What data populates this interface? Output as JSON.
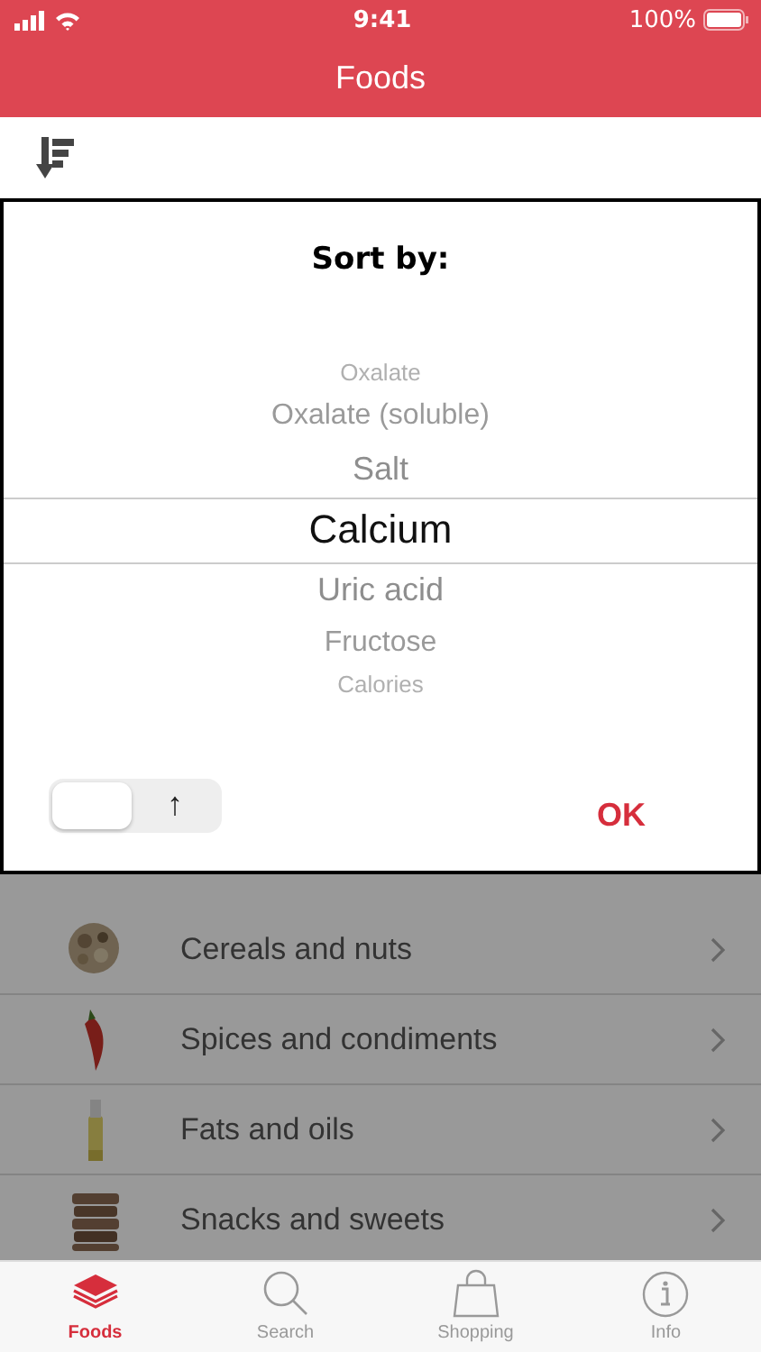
{
  "status_bar": {
    "time": "9:41",
    "battery": "100%"
  },
  "nav_bar": {
    "title": "Foods"
  },
  "sort_dialog": {
    "title": "Sort by:",
    "options": [
      {
        "label": "Oxalate",
        "selected": false
      },
      {
        "label": "Oxalate (soluble)",
        "selected": false
      },
      {
        "label": "Salt",
        "selected": false
      },
      {
        "label": "Calcium",
        "selected": true
      },
      {
        "label": "Uric acid",
        "selected": false
      },
      {
        "label": "Fructose",
        "selected": false
      },
      {
        "label": "Calories",
        "selected": false
      }
    ],
    "direction_toggle": {
      "label": "↑",
      "on": false
    },
    "ok_button": "OK"
  },
  "food_categories": [
    {
      "label": "Cereals and nuts",
      "kind": "picture"
    },
    {
      "label": "Spices and condiments",
      "kind": "picture"
    },
    {
      "label": "Fats and oils",
      "kind": "picture"
    },
    {
      "label": "Snacks and sweets",
      "kind": "picture"
    }
  ],
  "tab_bar": [
    {
      "label": "Foods",
      "selected": true
    },
    {
      "label": "Search",
      "selected": false
    },
    {
      "label": "Shopping",
      "selected": false
    },
    {
      "label": "Info",
      "selected": false
    }
  ]
}
